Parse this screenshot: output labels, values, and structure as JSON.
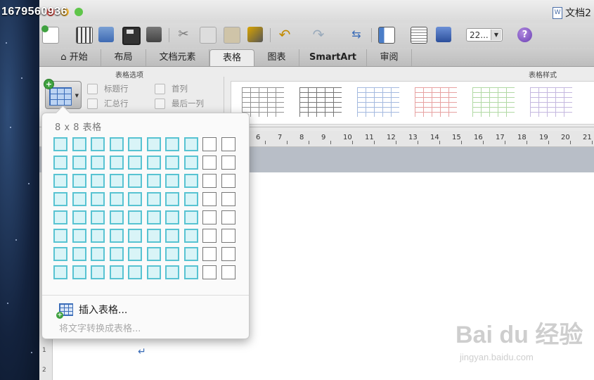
{
  "desktop": {
    "overlay_number": "1679560936"
  },
  "window": {
    "doc_title": "文档2",
    "traffic_colors": [
      "#ec5b54",
      "#f2b73b",
      "#5fc54a"
    ]
  },
  "toolbar": {
    "zoom_value": "22...",
    "help_label": "?",
    "icons": [
      "new-document-icon",
      "gallery-icon",
      "open-icon",
      "save-icon",
      "print-icon",
      "cut-icon",
      "copy-icon",
      "paste-icon",
      "format-painter-icon",
      "undo-icon",
      "redo-icon",
      "insert-icon",
      "sidebar-icon",
      "toolbox-icon",
      "media-browser-icon",
      "zoom-dropdown",
      "help-icon"
    ]
  },
  "ribbon": {
    "tabs": [
      {
        "label": "开始",
        "icon": "home-icon"
      },
      {
        "label": "布局"
      },
      {
        "label": "文档元素"
      },
      {
        "label": "表格",
        "active": true
      },
      {
        "label": "图表"
      },
      {
        "label": "SmartArt"
      },
      {
        "label": "审阅"
      }
    ],
    "group_table_options": "表格选项",
    "group_table_styles": "表格样式",
    "options": {
      "header_row": "标题行",
      "total_row": "汇总行",
      "first_column": "首列",
      "last_column": "最后一列"
    },
    "style_colors": [
      "#7a7a7a",
      "#555555",
      "#8fa9d8",
      "#e28b8b",
      "#9fd08f",
      "#b7a7d8"
    ]
  },
  "ruler": {
    "labels": [
      "6",
      "7",
      "8",
      "9",
      "10",
      "11",
      "12",
      "13",
      "14",
      "15",
      "16",
      "17",
      "18",
      "19",
      "20",
      "21"
    ]
  },
  "vertical_ruler": {
    "labels": [
      "1",
      "2"
    ]
  },
  "table_popup": {
    "grid_label": "8 x 8 表格",
    "selected_rows": 8,
    "selected_cols": 8,
    "total_rows": 8,
    "total_cols": 10,
    "insert_table": "插入表格...",
    "convert_text": "将文字转换成表格..."
  },
  "document": {
    "paragraph_mark": "↵"
  },
  "watermark": {
    "main": "Bai du 经验",
    "sub": "jingyan.baidu.com"
  }
}
